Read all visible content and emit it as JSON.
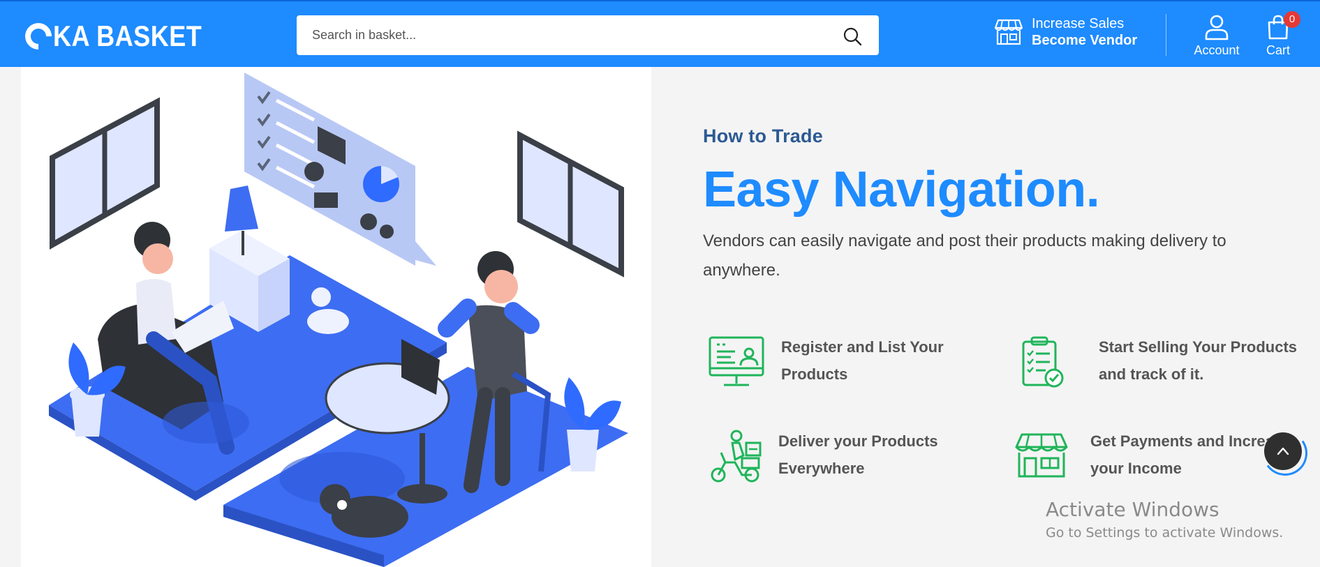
{
  "header": {
    "logo_text": "KA BASKET",
    "search": {
      "placeholder": "Search in basket..."
    },
    "vendor": {
      "line1": "Increase Sales",
      "line2": "Become Vendor"
    },
    "account_label": "Account",
    "cart_label": "Cart",
    "cart_count": "0"
  },
  "main": {
    "kicker": "How to Trade",
    "headline": "Easy Navigation.",
    "description": "Vendors can easily navigate and post their products making delivery to anywhere.",
    "features": [
      {
        "icon": "monitor-user-icon",
        "label": "Register and List Your Products"
      },
      {
        "icon": "clipboard-check-icon",
        "label": "Start Selling Your Products and track of it."
      },
      {
        "icon": "delivery-scooter-icon",
        "label": "Deliver your Products Everywhere"
      },
      {
        "icon": "storefront-icon",
        "line1": "Get Payments and Increa",
        "line2": "your Income"
      }
    ]
  },
  "watermark": {
    "line1": "Activate Windows",
    "line2": "Go to Settings to activate Windows."
  },
  "colors": {
    "brand": "#1e8bff",
    "accent_green": "#1fb55a",
    "illustration_blue": "#3d6df2"
  }
}
